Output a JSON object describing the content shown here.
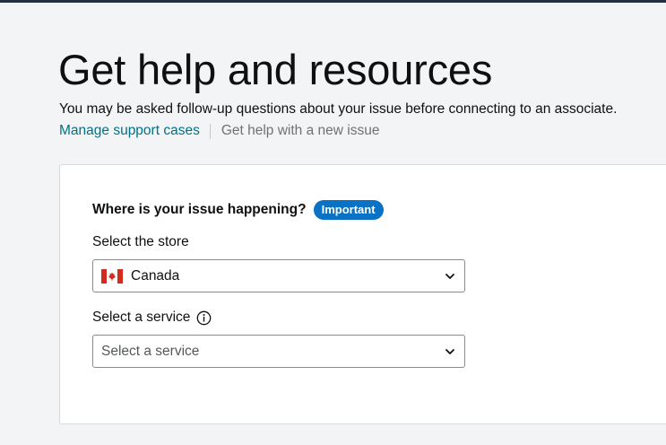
{
  "header": {
    "title": "Get help and resources",
    "subtitle": "You may be asked follow-up questions about your issue before connecting to an associate.",
    "nav": {
      "manage_label": "Manage support cases",
      "new_issue_label": "Get help with a new issue"
    }
  },
  "form": {
    "question": "Where is your issue happening?",
    "badge": "Important",
    "store": {
      "label": "Select the store",
      "value": "Canada",
      "flag_icon": "canada-flag-icon"
    },
    "service": {
      "label": "Select a service",
      "placeholder": "Select a service",
      "info_icon": "info-icon"
    }
  },
  "colors": {
    "link": "#007185",
    "muted_link": "#6f7373",
    "badge": "#0a72c4",
    "background": "#f2f4f5",
    "card_border": "#d5d9d9",
    "top_strip": "#232f3e"
  }
}
